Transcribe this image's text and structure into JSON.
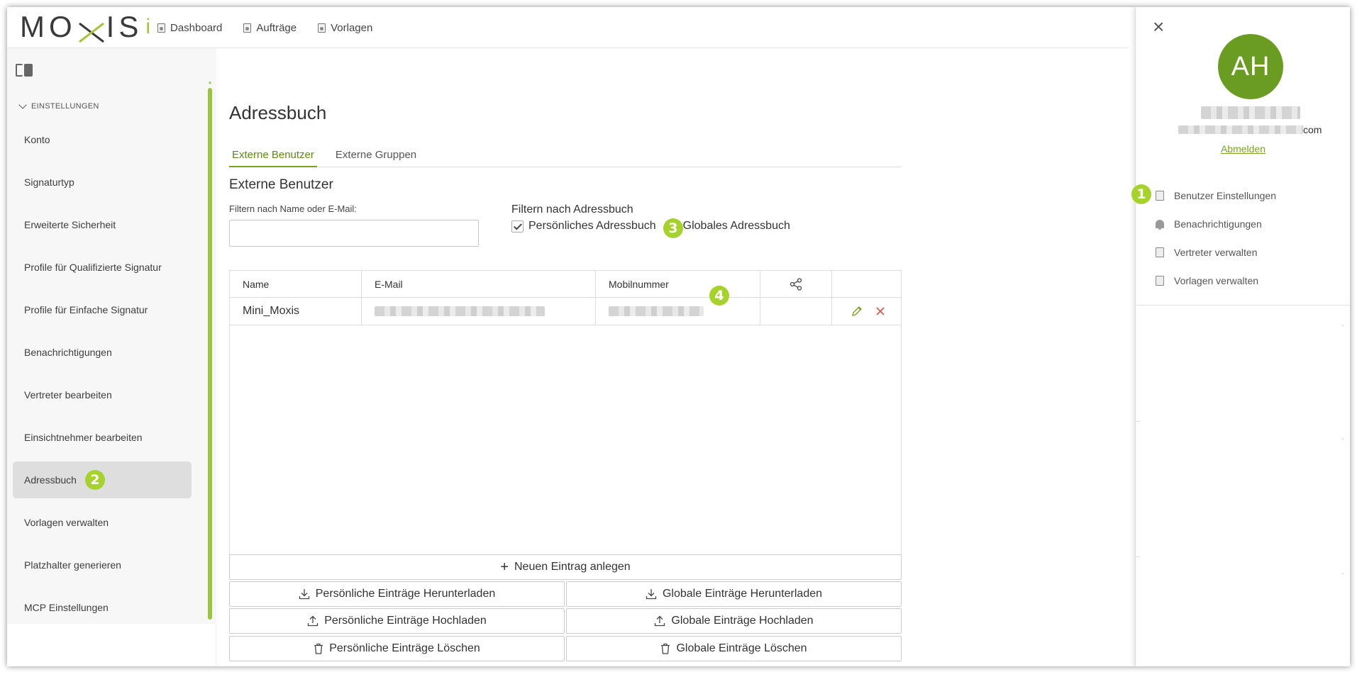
{
  "app": {
    "logo_text_left": "MO",
    "logo_text_right": "IS",
    "logo_suffix": "i",
    "brand_color": "#a3c639"
  },
  "topnav": [
    {
      "label": "Dashboard",
      "icon": "document-icon"
    },
    {
      "label": "Aufträge",
      "icon": "document-icon"
    },
    {
      "label": "Vorlagen",
      "icon": "document-icon"
    }
  ],
  "sidebar": {
    "section": "EINSTELLUNGEN",
    "items": [
      {
        "label": "Konto"
      },
      {
        "label": "Signaturtyp"
      },
      {
        "label": "Erweiterte Sicherheit"
      },
      {
        "label": "Profile für Qualifizierte Signatur"
      },
      {
        "label": "Profile für Einfache Signatur"
      },
      {
        "label": "Benachrichtigungen"
      },
      {
        "label": "Vertreter bearbeiten"
      },
      {
        "label": "Einsichtnehmer bearbeiten"
      },
      {
        "label": "Adressbuch",
        "active": true
      },
      {
        "label": "Vorlagen verwalten"
      },
      {
        "label": "Platzhalter generieren"
      },
      {
        "label": "MCP Einstellungen"
      }
    ]
  },
  "main": {
    "title": "Adressbuch",
    "tabs": [
      {
        "label": "Externe Benutzer",
        "active": true
      },
      {
        "label": "Externe Gruppen"
      }
    ],
    "section_title": "Externe Benutzer",
    "filter_label": "Filtern nach Name oder E-Mail:",
    "filter_value": "",
    "addressbook_filter_label": "Filtern nach Adressbuch",
    "checkboxes": [
      {
        "label": "Persönliches Adressbuch",
        "checked": true
      },
      {
        "label": "Globales Adressbuch",
        "checked": true
      }
    ],
    "table": {
      "columns": [
        "Name",
        "E-Mail",
        "Mobilnummer"
      ],
      "rows": [
        {
          "name": "Mini_Moxis"
        }
      ]
    },
    "buttons": {
      "new_entry": "Neuen Eintrag anlegen",
      "personal_download": "Persönliche Einträge Herunterladen",
      "global_download": "Globale Einträge Herunterladen",
      "personal_upload": "Persönliche Einträge Hochladen",
      "global_upload": "Globale Einträge Hochladen",
      "personal_delete": "Persönliche Einträge Löschen",
      "global_delete": "Globale Einträge Löschen"
    }
  },
  "annotations": [
    "1",
    "2",
    "3",
    "4"
  ],
  "user_panel": {
    "initials": "AH",
    "avatar_color": "#6a9c22",
    "email_suffix": "com",
    "logout": "Abmelden",
    "menu": [
      {
        "label": "Benutzer Einstellungen",
        "icon": "user-card-icon"
      },
      {
        "label": "Benachrichtigungen",
        "icon": "bell-icon"
      },
      {
        "label": "Vertreter verwalten",
        "icon": "document-icon"
      },
      {
        "label": "Vorlagen verwalten",
        "icon": "document-icon"
      }
    ]
  },
  "colors": {
    "accent_green": "#7aa520",
    "badge_green": "#a6d22c",
    "danger_red": "#d9534f"
  }
}
